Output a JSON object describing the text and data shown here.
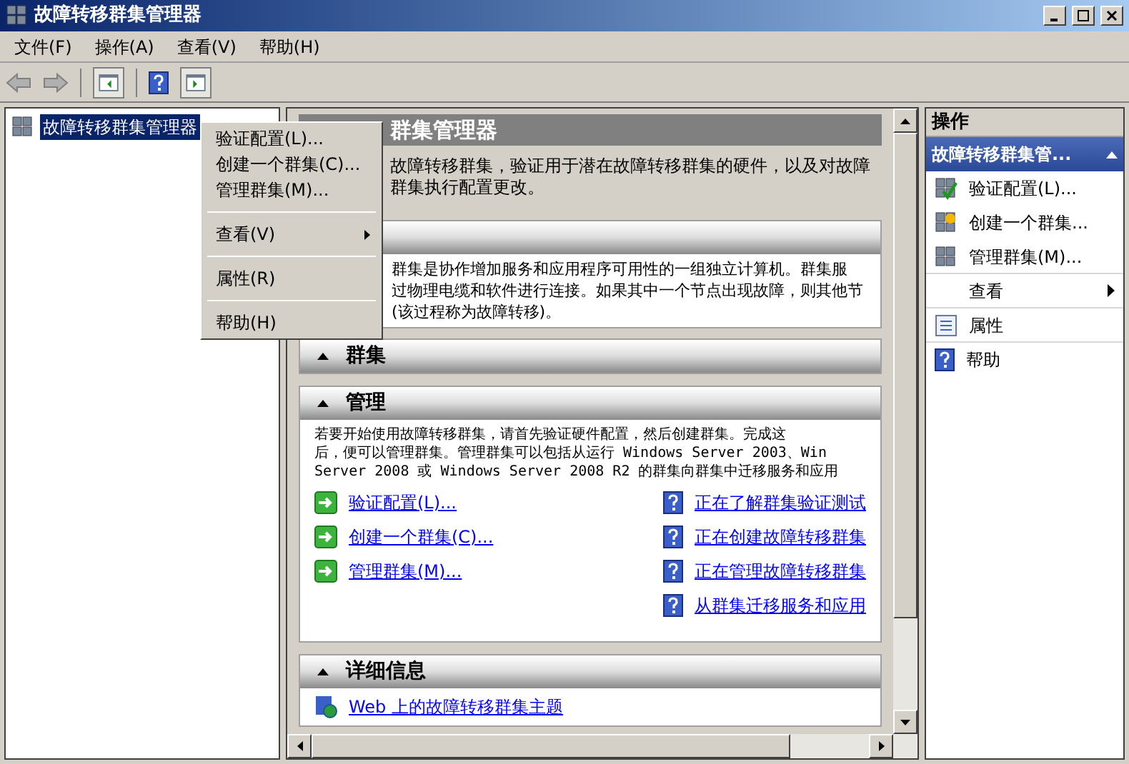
{
  "window": {
    "title": "故障转移群集管理器"
  },
  "menu_bar": [
    "文件(F)",
    "操作(A)",
    "查看(V)",
    "帮助(H)"
  ],
  "tree": [
    {
      "label": "故障转移群集管理器",
      "selected": true
    }
  ],
  "context_menu": [
    {
      "kind": "item",
      "label": "验证配置(L)..."
    },
    {
      "kind": "item",
      "label": "创建一个群集(C)..."
    },
    {
      "kind": "item",
      "label": "管理群集(M)..."
    },
    {
      "kind": "separator"
    },
    {
      "kind": "submenu",
      "label": "查看(V)"
    },
    {
      "kind": "separator"
    },
    {
      "kind": "item",
      "label": "属性(R)"
    },
    {
      "kind": "separator"
    },
    {
      "kind": "item",
      "label": "帮助(H)"
    }
  ],
  "content": {
    "header": "群集管理器",
    "intro": [
      "故障转移群集，验证用于潜在故障转移群集的硬件，以及对故障",
      "群集执行配置更改。"
    ],
    "overview_lines": [
      "群集是协作增加服务和应用程序可用性的一组独立计算机。群集服",
      "过物理电缆和软件进行连接。如果其中一个节点出现故障，则其他节",
      "(该过程称为故障转移)。"
    ],
    "sections": [
      {
        "title": "群集"
      },
      {
        "title": "管理",
        "text_lines": [
          "若要开始使用故障转移群集，请首先验证硬件配置，然后创建群集。完成这",
          "后，便可以管理群集。管理群集可以包括从运行 Windows Server 2003、Win",
          "Server 2008 或 Windows Server 2008 R2 的群集向群集中迁移服务和应用"
        ],
        "actions": [
          "验证配置(L)...",
          "创建一个群集(C)...",
          "管理群集(M)..."
        ],
        "help_links": [
          "正在了解群集验证测试",
          "正在创建故障转移群集",
          "正在管理故障转移群集",
          "从群集迁移服务和应用"
        ]
      },
      {
        "title": "详细信息",
        "web_links": [
          "Web 上的故障转移群集主题"
        ]
      }
    ]
  },
  "actions_pane": {
    "title": "操作",
    "group": "故障转移群集管...",
    "items": [
      {
        "kind": "validate",
        "label": "验证配置(L)..."
      },
      {
        "kind": "create",
        "label": "创建一个群集..."
      },
      {
        "kind": "manage",
        "label": "管理群集(M)..."
      },
      {
        "kind": "submenu",
        "label": "查看"
      },
      {
        "kind": "properties",
        "label": "属性"
      },
      {
        "kind": "help",
        "label": "帮助"
      }
    ]
  }
}
